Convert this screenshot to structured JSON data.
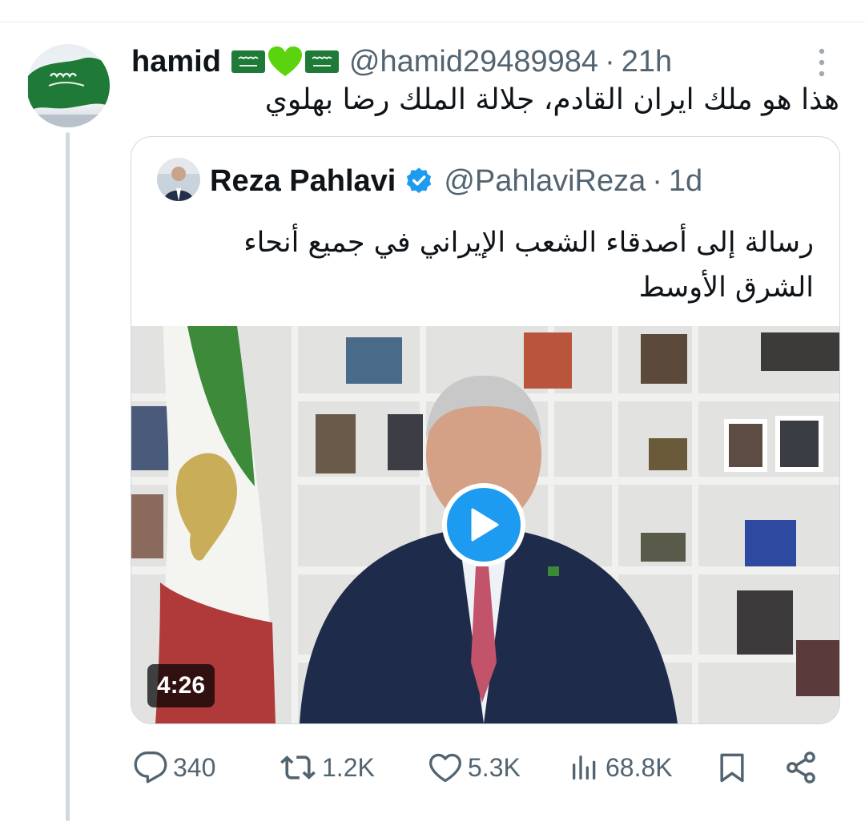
{
  "tweet": {
    "display_name": "hamid",
    "name_emojis": [
      "saudi-flag",
      "green-heart",
      "saudi-flag"
    ],
    "handle": "@hamid29489984",
    "separator": "·",
    "time": "21h",
    "text": "هذا هو ملك ايران القادم، جلالة الملك رضا بهلوي"
  },
  "quote": {
    "display_name": "Reza Pahlavi",
    "verified": true,
    "handle": "@PahlaviReza",
    "separator": "·",
    "time": "1d",
    "text": "رسالة إلى أصدقاء الشعب الإيراني في جميع أنحاء الشرق الأوسط",
    "video": {
      "duration": "4:26"
    }
  },
  "actions": {
    "replies": "340",
    "reposts": "1.2K",
    "likes": "5.3K",
    "views": "68.8K"
  },
  "icons": [
    "comment-icon",
    "repost-icon",
    "heart-icon",
    "views-icon",
    "bookmark-icon",
    "share-icon",
    "play-icon",
    "verified-badge-icon"
  ],
  "colors": {
    "accent": "#1d9bf0",
    "muted": "#536471",
    "text": "#0f1419",
    "border": "#cfd9de"
  }
}
